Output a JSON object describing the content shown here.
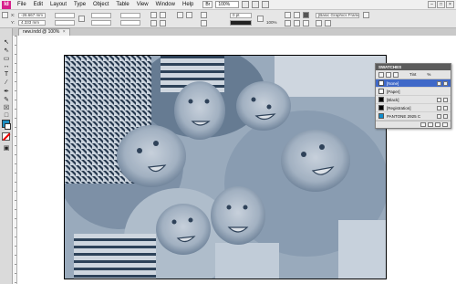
{
  "app": {
    "logo": "Id"
  },
  "menu": [
    "File",
    "Edit",
    "Layout",
    "Type",
    "Object",
    "Table",
    "View",
    "Window",
    "Help"
  ],
  "menubar_extra": {
    "mode_label": "Br",
    "zoom": "100%"
  },
  "window_controls": [
    "–",
    "□",
    "×"
  ],
  "control": {
    "x": "-26.667 mm",
    "y": "4.333 mm",
    "stroke_weight": "0 pt",
    "percent": "100%",
    "frame_style": "[Basic Graphics Frame]+"
  },
  "document_tab": {
    "title": "new.indd @ 100%",
    "close": "×"
  },
  "swatches_panel": {
    "title": "SWATCHES",
    "tint_label": "Tint",
    "percent_sign": "%",
    "items": [
      {
        "name": "[None]",
        "color": "#ffffff",
        "selected": true
      },
      {
        "name": "[Paper]",
        "color": "#ffffff",
        "selected": false
      },
      {
        "name": "[Black]",
        "color": "#000000",
        "selected": false
      },
      {
        "name": "[Registration]",
        "color": "#000000",
        "selected": false
      },
      {
        "name": "PANTONE 2925 C",
        "color": "#0f8fd0",
        "selected": false
      }
    ]
  },
  "colors": {
    "fill": "#1d8fc3",
    "accent_selection": "#3f68c8",
    "photo_tone": "#3d5a78"
  }
}
